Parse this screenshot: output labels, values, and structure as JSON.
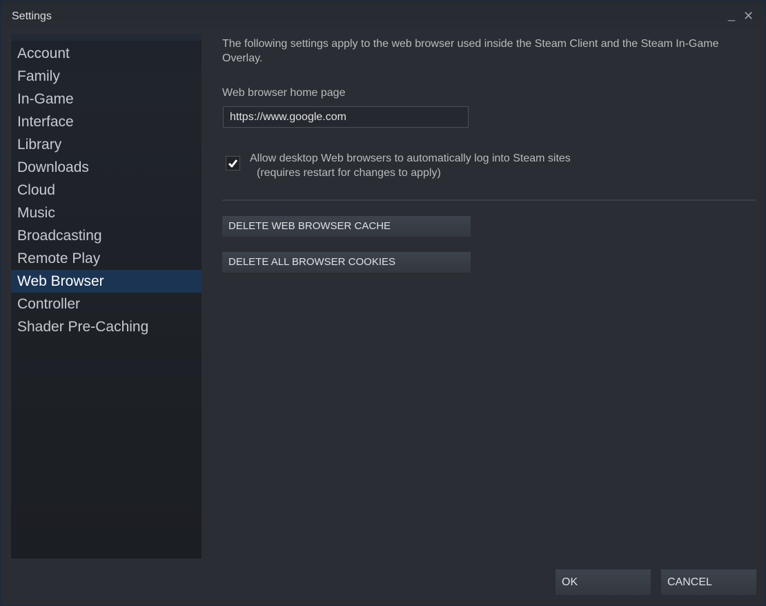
{
  "window": {
    "title": "Settings",
    "minimize_glyph": "_",
    "close_glyph": "✕"
  },
  "sidebar": {
    "items": [
      {
        "label": "Account"
      },
      {
        "label": "Family"
      },
      {
        "label": "In-Game"
      },
      {
        "label": "Interface"
      },
      {
        "label": "Library"
      },
      {
        "label": "Downloads"
      },
      {
        "label": "Cloud"
      },
      {
        "label": "Music"
      },
      {
        "label": "Broadcasting"
      },
      {
        "label": "Remote Play"
      },
      {
        "label": "Web Browser",
        "active": true
      },
      {
        "label": "Controller"
      },
      {
        "label": "Shader Pre-Caching"
      }
    ]
  },
  "content": {
    "intro": "The following settings apply to the web browser used inside the Steam Client and the Steam In-Game Overlay.",
    "home_page_label": "Web browser home page",
    "home_page_value": "https://www.google.com",
    "auto_login": {
      "checked": true,
      "label": "Allow desktop Web browsers to automatically log into Steam sites",
      "sublabel": "(requires restart for changes to apply)"
    },
    "buttons": {
      "delete_cache": "DELETE WEB BROWSER CACHE",
      "delete_cookies": "DELETE ALL BROWSER COOKIES"
    }
  },
  "footer": {
    "ok": "OK",
    "cancel": "CANCEL"
  },
  "colors": {
    "active_item_bg": "#1b3453",
    "window_bg": "#2a2d33",
    "sidebar_bg": "#1b1e22"
  }
}
